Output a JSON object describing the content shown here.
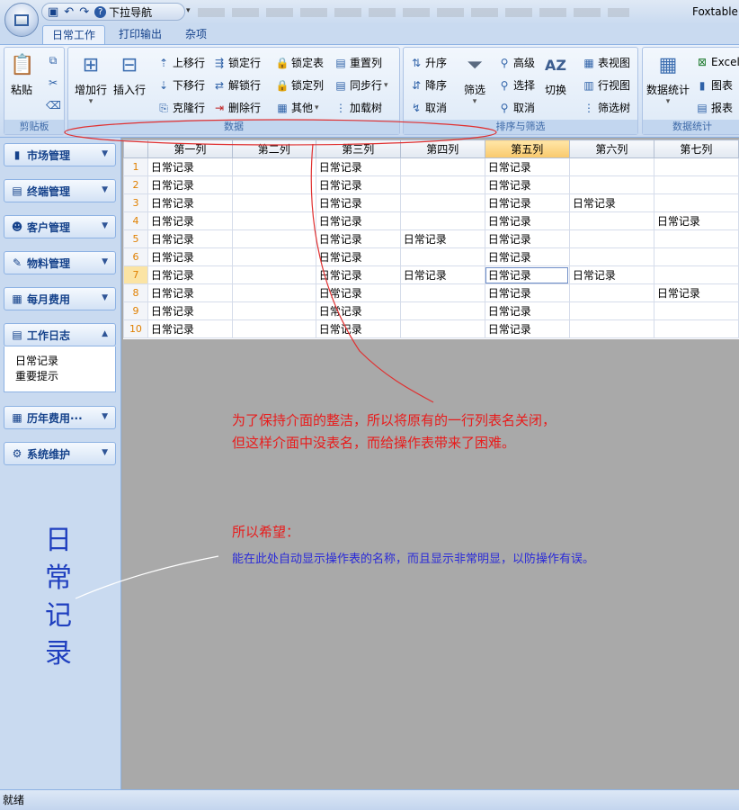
{
  "app": {
    "title": "Foxtable",
    "quick_nav": "下拉导航"
  },
  "tabs": [
    "日常工作",
    "打印输出",
    "杂项"
  ],
  "ribbon": {
    "clipboard": {
      "label": "剪贴板",
      "paste": "粘贴"
    },
    "data": {
      "label": "数据",
      "add_row": "增加行",
      "insert_row": "插入行",
      "move_up": "上移行",
      "move_down": "下移行",
      "clone_row": "克隆行",
      "lock_row": "锁定行",
      "unlock_row": "解锁行",
      "delete_row": "删除行",
      "lock_table": "锁定表",
      "lock_col": "锁定列",
      "other": "其他",
      "reset_col": "重置列",
      "sync_row": "同步行",
      "load_tree": "加载树"
    },
    "sort": {
      "label": "排序与筛选",
      "asc": "升序",
      "desc": "降序",
      "cancel_sort": "取消",
      "filter": "筛选",
      "advanced": "高级",
      "select": "选择",
      "cancel_filter": "取消",
      "switch": "切换",
      "table_view": "表视图",
      "row_view": "行视图",
      "filter_tree": "筛选树"
    },
    "stats": {
      "label": "数据统计",
      "stats_btn": "数据统计",
      "excel": "Excel",
      "chart": "图表",
      "report": "报表"
    }
  },
  "sidebar": {
    "items": [
      "市场管理",
      "终端管理",
      "客户管理",
      "物料管理",
      "每月费用",
      "工作日志",
      "历年费用···",
      "系统维护"
    ],
    "panel_items": [
      "日常记录",
      "重要提示"
    ]
  },
  "grid": {
    "columns": [
      "第一列",
      "第二列",
      "第三列",
      "第四列",
      "第五列",
      "第六列",
      "第七列"
    ],
    "rows": [
      [
        "1",
        "日常记录",
        "",
        "日常记录",
        "",
        "日常记录",
        "",
        ""
      ],
      [
        "2",
        "日常记录",
        "",
        "日常记录",
        "",
        "日常记录",
        "",
        ""
      ],
      [
        "3",
        "日常记录",
        "",
        "日常记录",
        "",
        "日常记录",
        "日常记录",
        ""
      ],
      [
        "4",
        "日常记录",
        "",
        "日常记录",
        "",
        "日常记录",
        "",
        "日常记录"
      ],
      [
        "5",
        "日常记录",
        "",
        "日常记录",
        "日常记录",
        "日常记录",
        "",
        ""
      ],
      [
        "6",
        "日常记录",
        "",
        "日常记录",
        "",
        "日常记录",
        "",
        ""
      ],
      [
        "7",
        "日常记录",
        "",
        "日常记录",
        "日常记录",
        "日常记录",
        "日常记录",
        ""
      ],
      [
        "8",
        "日常记录",
        "",
        "日常记录",
        "",
        "日常记录",
        "",
        "日常记录"
      ],
      [
        "9",
        "日常记录",
        "",
        "日常记录",
        "",
        "日常记录",
        "",
        ""
      ],
      [
        "10",
        "日常记录",
        "",
        "日常记录",
        "",
        "日常记录",
        "",
        ""
      ]
    ]
  },
  "annotations": {
    "note1_line1": "为了保持介面的整洁，所以将原有的一行列表名关闭，",
    "note1_line2": "但这样介面中没表名，而给操作表带来了困难。",
    "note2": "所以希望：",
    "note3": "能在此处自动显示操作表的名称，而且显示非常明显，以防操作有误。",
    "big_text": [
      "日",
      "常",
      "记",
      "录"
    ]
  },
  "status": "就绪"
}
